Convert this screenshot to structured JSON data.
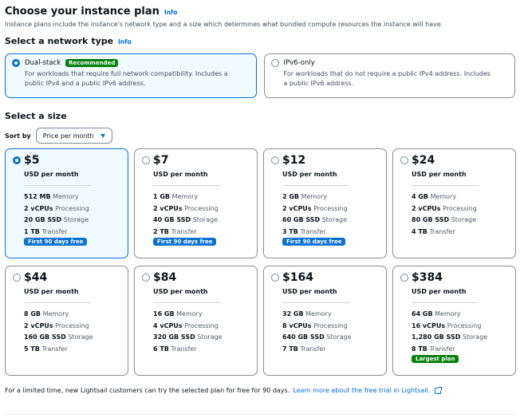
{
  "header": {
    "title": "Choose your instance plan",
    "info": "Info",
    "description": "Instance plans include the instance's network type and a size which determines what bundled compute resources the instance will have."
  },
  "network": {
    "title": "Select a network type",
    "info": "Info",
    "options": [
      {
        "label": "Dual-stack",
        "badge": "Recommended",
        "desc_line1": "For workloads that require full network compatibility. Includes a",
        "desc_line2": "public IPv4 and a public IPv6 address.",
        "selected": true
      },
      {
        "label": "IPv6-only",
        "desc_line1": "For workloads that do not require a public IPv4 address. Includes",
        "desc_line2": "a public IPv6 address.",
        "selected": false
      }
    ]
  },
  "size": {
    "title": "Select a size",
    "sort_label": "Sort by",
    "sort_value": "Price per month"
  },
  "plans": [
    {
      "price": "$5",
      "per": "USD per month",
      "memory": "512 MB",
      "vcpus": "2 vCPUs",
      "storage": "20 GB SSD",
      "transfer": "1 TB",
      "badge": "First 90 days free",
      "selected": true
    },
    {
      "price": "$7",
      "per": "USD per month",
      "memory": "1 GB",
      "vcpus": "2 vCPUs",
      "storage": "40 GB SSD",
      "transfer": "2 TB",
      "badge": "First 90 days free",
      "selected": false
    },
    {
      "price": "$12",
      "per": "USD per month",
      "memory": "2 GB",
      "vcpus": "2 vCPUs",
      "storage": "60 GB SSD",
      "transfer": "3 TB",
      "badge": "First 90 days free",
      "selected": false
    },
    {
      "price": "$24",
      "per": "USD per month",
      "memory": "4 GB",
      "vcpus": "2 vCPUs",
      "storage": "80 GB SSD",
      "transfer": "4 TB",
      "selected": false
    },
    {
      "price": "$44",
      "per": "USD per month",
      "memory": "8 GB",
      "vcpus": "2 vCPUs",
      "storage": "160 GB SSD",
      "transfer": "5 TB",
      "selected": false
    },
    {
      "price": "$84",
      "per": "USD per month",
      "memory": "16 GB",
      "vcpus": "4 vCPUs",
      "storage": "320 GB SSD",
      "transfer": "6 TB",
      "selected": false
    },
    {
      "price": "$164",
      "per": "USD per month",
      "memory": "32 GB",
      "vcpus": "8 vCPUs",
      "storage": "640 GB SSD",
      "transfer": "7 TB",
      "selected": false
    },
    {
      "price": "$384",
      "per": "USD per month",
      "memory": "64 GB",
      "vcpus": "16 vCPUs",
      "storage": "1,280 GB SSD",
      "transfer": "8 TB",
      "badge_green": "Largest plan",
      "selected": false
    }
  ],
  "spec_units": {
    "memory": "Memory",
    "vcpus": "Processing",
    "storage": "Storage",
    "transfer": "Transfer"
  },
  "footer": {
    "text": "For a limited time, new Lightsail customers can try the selected plan for free for 90 days.",
    "link": "Learn more about the free trial in Lightsail."
  },
  "colors": {
    "accent": "#0972d3",
    "selected_bg": "#f0fbff",
    "success": "#037f0c"
  }
}
